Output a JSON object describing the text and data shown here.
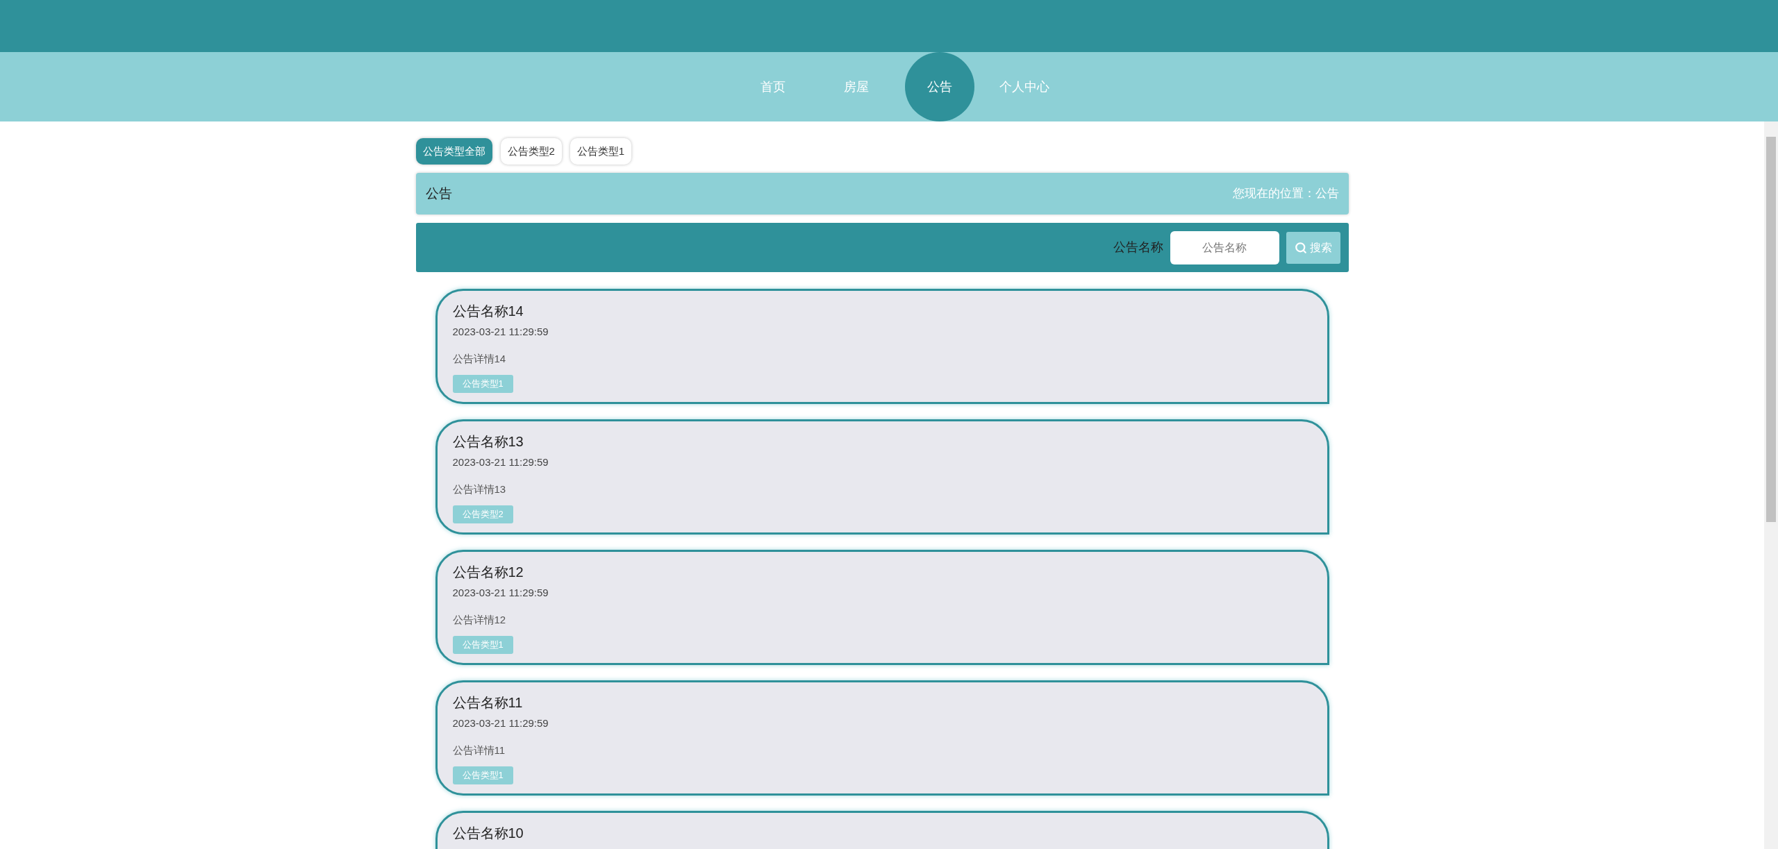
{
  "nav": [
    {
      "label": "首页",
      "selected": false
    },
    {
      "label": "房屋",
      "selected": false
    },
    {
      "label": "公告",
      "selected": true
    },
    {
      "label": "个人中心",
      "selected": false
    }
  ],
  "type_filters": [
    {
      "label": "公告类型全部",
      "selected": true
    },
    {
      "label": "公告类型2",
      "selected": false
    },
    {
      "label": "公告类型1",
      "selected": false
    }
  ],
  "breadcrumb": {
    "title": "公告",
    "location": "您现在的位置：公告"
  },
  "search": {
    "label": "公告名称",
    "placeholder": "公告名称",
    "button": "搜索"
  },
  "notices": [
    {
      "title": "公告名称14",
      "time": "2023-03-21 11:29:59",
      "detail": "公告详情14",
      "type": "公告类型1"
    },
    {
      "title": "公告名称13",
      "time": "2023-03-21 11:29:59",
      "detail": "公告详情13",
      "type": "公告类型2"
    },
    {
      "title": "公告名称12",
      "time": "2023-03-21 11:29:59",
      "detail": "公告详情12",
      "type": "公告类型1"
    },
    {
      "title": "公告名称11",
      "time": "2023-03-21 11:29:59",
      "detail": "公告详情11",
      "type": "公告类型1"
    },
    {
      "title": "公告名称10"
    }
  ]
}
